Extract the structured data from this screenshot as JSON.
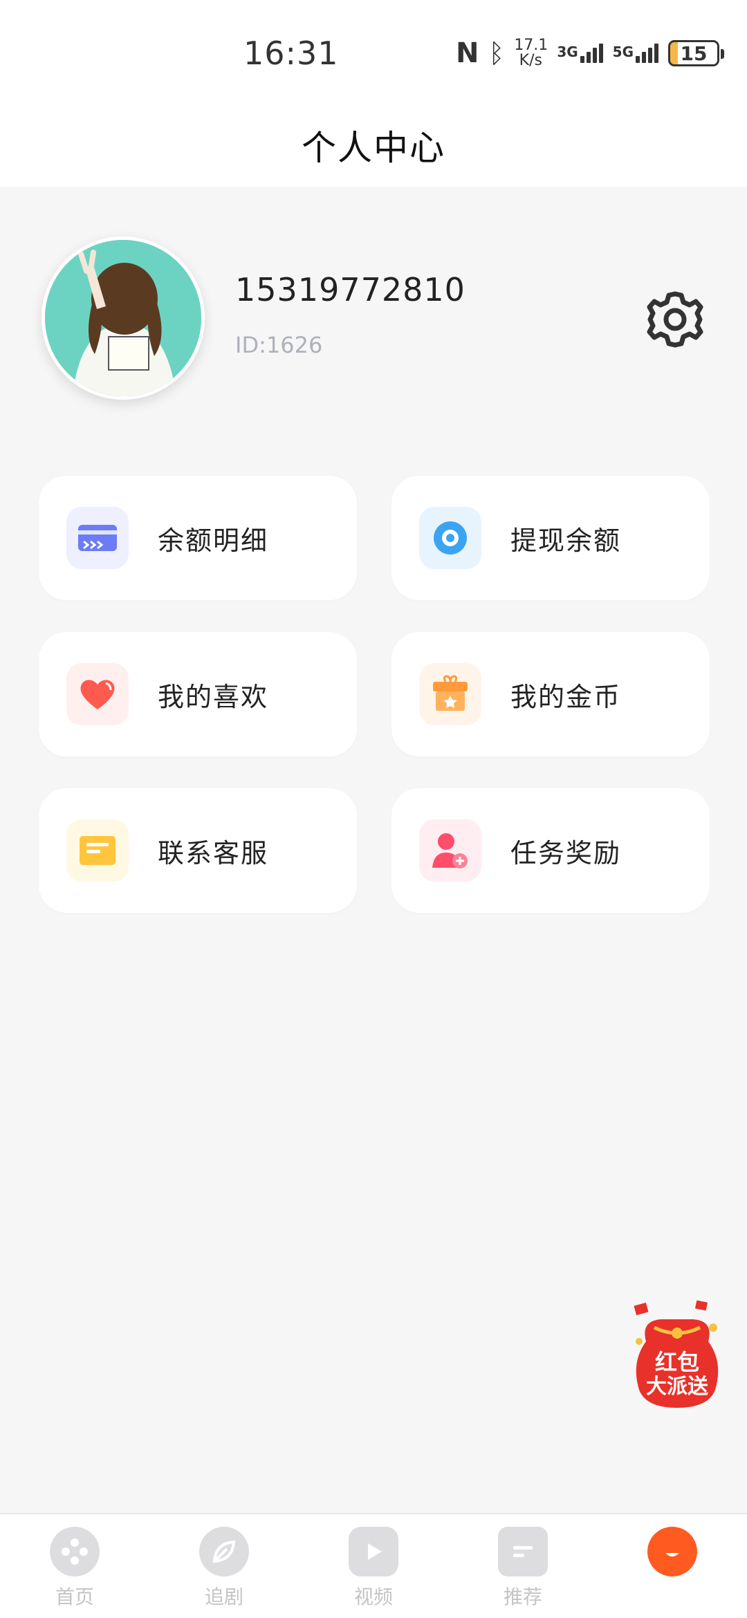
{
  "status": {
    "time": "16:31",
    "speed_value": "17.1",
    "speed_unit": "K/s",
    "net1": "3G",
    "net2": "5G",
    "battery": "15"
  },
  "header": {
    "title": "个人中心"
  },
  "profile": {
    "phone": "15319772810",
    "user_id": "ID:1626"
  },
  "menu": [
    {
      "label": "余额明细",
      "icon": "card-icon",
      "color": "#6b7cf6"
    },
    {
      "label": "提现余额",
      "icon": "withdraw-icon",
      "color": "#3aa4f2"
    },
    {
      "label": "我的喜欢",
      "icon": "heart-icon",
      "color": "#ff5a4e"
    },
    {
      "label": "我的金币",
      "icon": "gift-box-icon",
      "color": "#ff9a3c"
    },
    {
      "label": "联系客服",
      "icon": "message-icon",
      "color": "#ffc53d"
    },
    {
      "label": "任务奖励",
      "icon": "user-add-icon",
      "color": "#ff4d6a"
    }
  ],
  "promo": {
    "line1": "红包",
    "line2": "大派送"
  },
  "tabs": [
    {
      "label": "首页",
      "icon": "film-reel-icon"
    },
    {
      "label": "追剧",
      "icon": "leaf-icon"
    },
    {
      "label": "视频",
      "icon": "play-icon"
    },
    {
      "label": "推荐",
      "icon": "list-icon"
    },
    {
      "label": "",
      "icon": "profile-icon",
      "active": true
    }
  ]
}
